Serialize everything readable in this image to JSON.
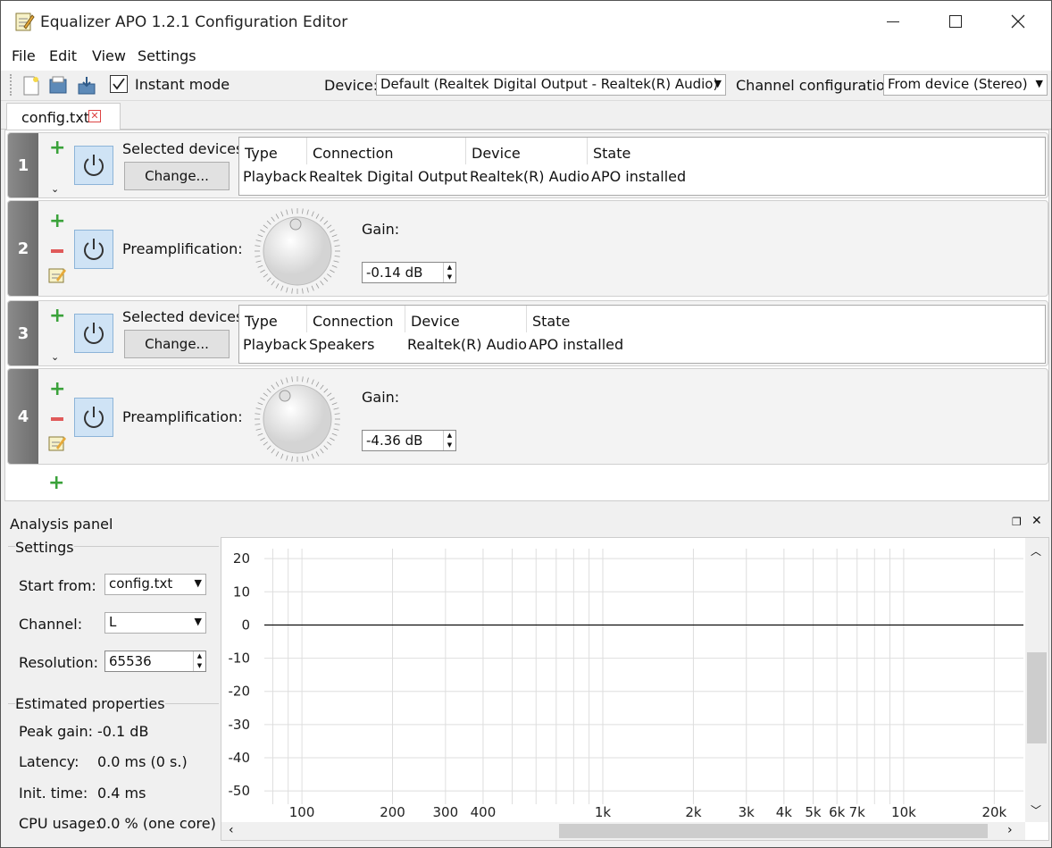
{
  "window": {
    "title": "Equalizer APO 1.2.1 Configuration Editor"
  },
  "menu": [
    "File",
    "Edit",
    "View",
    "Settings"
  ],
  "toolbar": {
    "instant_mode_label": "Instant mode",
    "instant_mode_checked": true,
    "device_label": "Device:",
    "device_value": "Default (Realtek Digital Output - Realtek(R) Audio)",
    "channel_label": "Channel configuration:",
    "channel_value": "From device (Stereo)"
  },
  "tab": {
    "label": "config.txt"
  },
  "rows": [
    {
      "num": "1",
      "kind": "devices",
      "label": "Selected devices:",
      "button": "Change...",
      "headers": [
        "Type",
        "Connection",
        "Device",
        "State"
      ],
      "cells": [
        "Playback",
        "Realtek Digital Output",
        "Realtek(R) Audio",
        "APO installed"
      ]
    },
    {
      "num": "2",
      "kind": "preamp",
      "label": "Preamplification:",
      "gain_label": "Gain:",
      "gain_value": "-0.14 dB"
    },
    {
      "num": "3",
      "kind": "devices",
      "label": "Selected devices:",
      "button": "Change...",
      "headers": [
        "Type",
        "Connection",
        "Device",
        "State"
      ],
      "cells": [
        "Playback",
        "Speakers",
        "Realtek(R) Audio",
        "APO installed"
      ]
    },
    {
      "num": "4",
      "kind": "preamp",
      "label": "Preamplification:",
      "gain_label": "Gain:",
      "gain_value": "-4.36 dB"
    }
  ],
  "analysis": {
    "title": "Analysis panel",
    "settings_title": "Settings",
    "start_from_label": "Start from:",
    "start_from_value": "config.txt",
    "channel_label": "Channel:",
    "channel_value": "L",
    "resolution_label": "Resolution:",
    "resolution_value": "65536",
    "est_title": "Estimated properties",
    "peak_label": "Peak gain:",
    "peak_value": "-0.1 dB",
    "latency_label": "Latency:",
    "latency_value": "0.0 ms (0 s.)",
    "init_label": "Init. time:",
    "init_value": "0.4 ms",
    "cpu_label": "CPU usage:",
    "cpu_value": "0.0 % (one core)"
  },
  "chart_data": {
    "type": "line",
    "y_ticks": [
      "20",
      "10",
      "0",
      "-10",
      "-20",
      "-30",
      "-40",
      "-50"
    ],
    "x_ticks": [
      "100",
      "200",
      "300",
      "400",
      "1k",
      "2k",
      "3k",
      "4k",
      "5k",
      "6k",
      "7k",
      "10k",
      "20k"
    ],
    "x_tick_values": [
      100,
      200,
      300,
      400,
      1000,
      2000,
      3000,
      4000,
      5000,
      6000,
      7000,
      10000,
      20000
    ],
    "x_scale": "log",
    "xlim": [
      75,
      25000
    ],
    "ylim": [
      -54,
      23
    ],
    "series": [
      {
        "x": [
          75,
          25000
        ],
        "y": [
          0,
          0
        ]
      }
    ]
  }
}
